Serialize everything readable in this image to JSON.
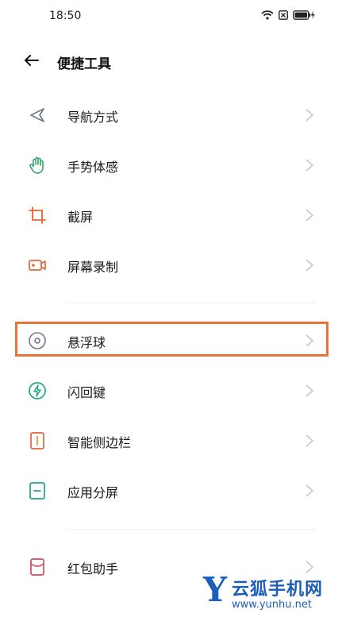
{
  "status_bar": {
    "time": "18:50"
  },
  "header": {
    "title": "便捷工具"
  },
  "sections": [
    {
      "items": [
        {
          "label": "导航方式",
          "icon": "navigation-arrow-icon"
        },
        {
          "label": "手势体感",
          "icon": "hand-gesture-icon"
        },
        {
          "label": "截屏",
          "icon": "crop-screenshot-icon"
        },
        {
          "label": "屏幕录制",
          "icon": "screen-record-icon"
        }
      ]
    },
    {
      "items": [
        {
          "label": "悬浮球",
          "icon": "floating-ball-icon",
          "highlighted": true
        },
        {
          "label": "闪回键",
          "icon": "flash-back-icon"
        },
        {
          "label": "智能侧边栏",
          "icon": "smart-sidebar-icon"
        },
        {
          "label": "应用分屏",
          "icon": "split-screen-icon"
        }
      ]
    },
    {
      "items": [
        {
          "label": "红包助手",
          "icon": "red-envelope-icon"
        }
      ]
    }
  ],
  "colors": {
    "highlight_border": "#e8743b",
    "icon_gray": "#6f7a86",
    "icon_green": "#2fa86a",
    "icon_orange": "#e0663a",
    "icon_teal": "#1aa68a",
    "watermark_blue": "#1d5fb8"
  },
  "watermark": {
    "logo_letter": "Y",
    "text": "云狐手机网",
    "url": "www.yunhu.net"
  }
}
